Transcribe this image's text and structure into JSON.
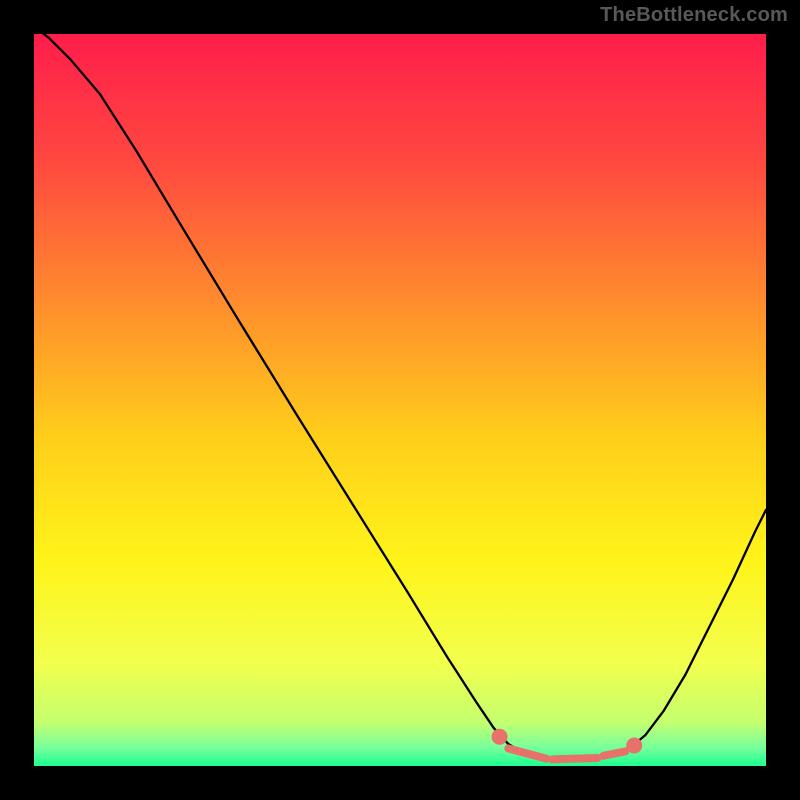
{
  "watermark": "TheBottleneck.com",
  "chart_data": {
    "type": "line",
    "title": "",
    "xlabel": "",
    "ylabel": "",
    "xlim": [
      0,
      1
    ],
    "ylim": [
      0,
      1
    ],
    "background": {
      "type": "vertical-gradient",
      "stops": [
        {
          "offset": 0.0,
          "color": "#ff1d4b"
        },
        {
          "offset": 0.18,
          "color": "#ff4a3f"
        },
        {
          "offset": 0.36,
          "color": "#ff8a2e"
        },
        {
          "offset": 0.55,
          "color": "#ffce1a"
        },
        {
          "offset": 0.72,
          "color": "#fff41a"
        },
        {
          "offset": 0.86,
          "color": "#f2ff4d"
        },
        {
          "offset": 0.94,
          "color": "#c4ff6e"
        },
        {
          "offset": 0.975,
          "color": "#77ff9c"
        },
        {
          "offset": 1.0,
          "color": "#1cff8f"
        }
      ]
    },
    "series": [
      {
        "name": "curve",
        "stroke": "#000000",
        "strokeWidth": 2.3,
        "points": [
          {
            "x": 0.0,
            "y": 1.01
          },
          {
            "x": 0.02,
            "y": 0.995
          },
          {
            "x": 0.05,
            "y": 0.965
          },
          {
            "x": 0.09,
            "y": 0.918
          },
          {
            "x": 0.14,
            "y": 0.84
          },
          {
            "x": 0.2,
            "y": 0.74
          },
          {
            "x": 0.28,
            "y": 0.608
          },
          {
            "x": 0.36,
            "y": 0.478
          },
          {
            "x": 0.44,
            "y": 0.35
          },
          {
            "x": 0.51,
            "y": 0.238
          },
          {
            "x": 0.565,
            "y": 0.148
          },
          {
            "x": 0.605,
            "y": 0.086
          },
          {
            "x": 0.628,
            "y": 0.052
          },
          {
            "x": 0.648,
            "y": 0.03
          },
          {
            "x": 0.668,
            "y": 0.018
          },
          {
            "x": 0.69,
            "y": 0.011
          },
          {
            "x": 0.715,
            "y": 0.008
          },
          {
            "x": 0.74,
            "y": 0.007
          },
          {
            "x": 0.765,
            "y": 0.009
          },
          {
            "x": 0.79,
            "y": 0.014
          },
          {
            "x": 0.812,
            "y": 0.023
          },
          {
            "x": 0.835,
            "y": 0.042
          },
          {
            "x": 0.86,
            "y": 0.075
          },
          {
            "x": 0.89,
            "y": 0.125
          },
          {
            "x": 0.92,
            "y": 0.185
          },
          {
            "x": 0.955,
            "y": 0.255
          },
          {
            "x": 0.985,
            "y": 0.32
          },
          {
            "x": 1.0,
            "y": 0.35
          }
        ]
      },
      {
        "name": "points-overlay",
        "type": "scatter",
        "fill": "#e8716a",
        "radius": 8,
        "points": [
          {
            "x": 0.636,
            "y": 0.04
          },
          {
            "x": 0.82,
            "y": 0.028
          }
        ]
      },
      {
        "name": "points-ridge",
        "type": "segments",
        "stroke": "#e8716a",
        "strokeWidth": 8,
        "segments": [
          {
            "x1": 0.648,
            "y1": 0.024,
            "x2": 0.7,
            "y2": 0.01
          },
          {
            "x1": 0.708,
            "y1": 0.009,
            "x2": 0.77,
            "y2": 0.011
          },
          {
            "x1": 0.778,
            "y1": 0.014,
            "x2": 0.808,
            "y2": 0.02
          }
        ]
      }
    ]
  }
}
